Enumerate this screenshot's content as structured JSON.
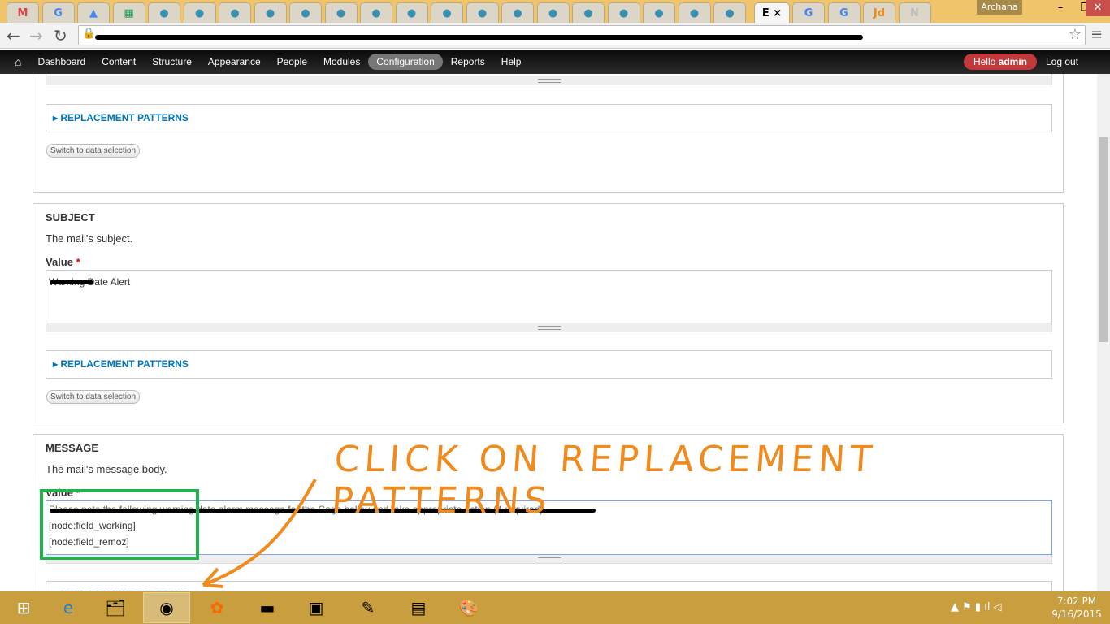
{
  "browser": {
    "tabs": [
      {
        "icon": "gmail",
        "label": "M"
      },
      {
        "icon": "google",
        "label": "G"
      },
      {
        "icon": "drive",
        "label": "▲"
      },
      {
        "icon": "sheets",
        "label": "▦"
      },
      {
        "icon": "drupal",
        "label": "●"
      },
      {
        "icon": "drupal",
        "label": "●"
      },
      {
        "icon": "drupal",
        "label": "●"
      },
      {
        "icon": "drupal",
        "label": "●"
      },
      {
        "icon": "drupal",
        "label": "●"
      },
      {
        "icon": "drupal",
        "label": "●"
      },
      {
        "icon": "drupal",
        "label": "●"
      },
      {
        "icon": "drupal",
        "label": "●"
      },
      {
        "icon": "drupal",
        "label": "●"
      },
      {
        "icon": "drupal",
        "label": "●"
      },
      {
        "icon": "drupal",
        "label": "●"
      },
      {
        "icon": "drupal",
        "label": "●"
      },
      {
        "icon": "drupal",
        "label": "●"
      },
      {
        "icon": "drupal",
        "label": "●"
      },
      {
        "icon": "drupal",
        "label": "●"
      },
      {
        "icon": "drupal",
        "label": "●"
      },
      {
        "icon": "drupal",
        "label": "●"
      }
    ],
    "active_tab": "E",
    "after_tabs": [
      {
        "icon": "google",
        "label": "G"
      },
      {
        "icon": "google",
        "label": "G"
      },
      {
        "icon": "jd",
        "label": "Jd"
      },
      {
        "icon": "page",
        "label": "N"
      }
    ],
    "profile": "Archana"
  },
  "toolbar": {
    "items": [
      "Dashboard",
      "Content",
      "Structure",
      "Appearance",
      "People",
      "Modules",
      "Configuration",
      "Reports",
      "Help"
    ],
    "active": "Configuration",
    "hello": "Hello",
    "user": "admin",
    "logout": "Log out"
  },
  "form": {
    "replacement_patterns": "REPLACEMENT PATTERNS",
    "switch_label": "Switch to data selection",
    "subject": {
      "legend": "SUBJECT",
      "description": "The mail's subject.",
      "label": "Value",
      "required": "*",
      "value": "Warning Date Alert"
    },
    "message": {
      "legend": "MESSAGE",
      "description": "The mail's message body.",
      "label": "Value",
      "required": "*",
      "lines": [
        "Please note the following warning date alarm message for the Cage below and take appropriate action (if required).",
        "[node:field_working]",
        "[node:field_remoz]"
      ]
    }
  },
  "annotation": {
    "text": "CLICK ON REPLACEMENT PATTERNS",
    "color": "#f08a1c",
    "highlight_color": "#22b14c"
  },
  "taskbar": {
    "time": "7:02 PM",
    "date": "9/16/2015"
  }
}
